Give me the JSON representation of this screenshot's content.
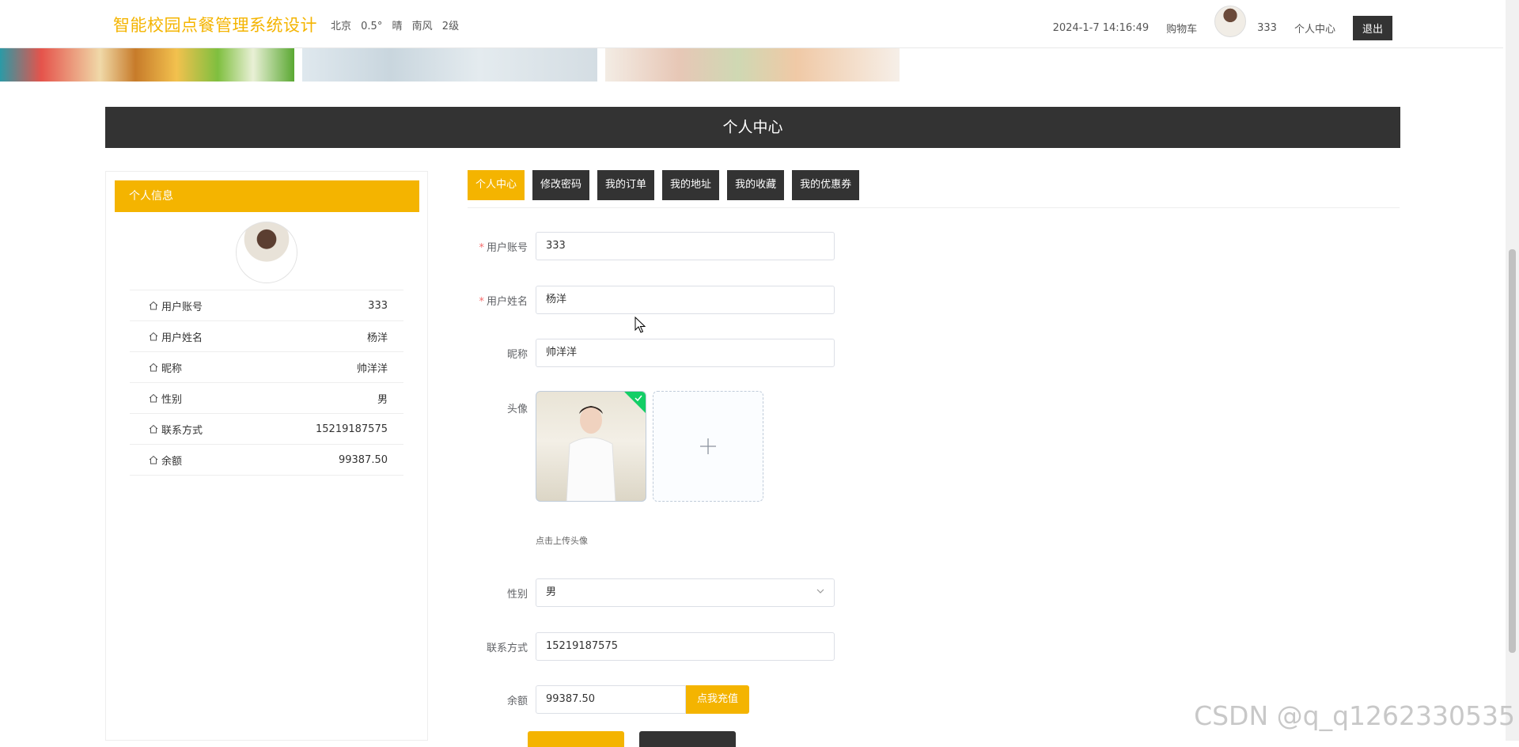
{
  "header": {
    "site_title": "智能校园点餐管理系统设计",
    "weather": {
      "city": "北京",
      "temp": "0.5°",
      "condition": "晴",
      "wind_dir": "南风",
      "wind_level": "2级"
    },
    "datetime": "2024-1-7 14:16:49",
    "cart_label": "购物车",
    "username": "333",
    "profile_label": "个人中心",
    "logout_label": "退出"
  },
  "page_title": "个人中心",
  "left_panel": {
    "heading": "个人信息",
    "rows": [
      {
        "label": "用户账号",
        "value": "333"
      },
      {
        "label": "用户姓名",
        "value": "杨洋"
      },
      {
        "label": "昵称",
        "value": "帅洋洋"
      },
      {
        "label": "性别",
        "value": "男"
      },
      {
        "label": "联系方式",
        "value": "15219187575"
      },
      {
        "label": "余额",
        "value": "99387.50"
      }
    ]
  },
  "tabs": [
    {
      "label": "个人中心",
      "active": true
    },
    {
      "label": "修改密码"
    },
    {
      "label": "我的订单"
    },
    {
      "label": "我的地址"
    },
    {
      "label": "我的收藏"
    },
    {
      "label": "我的优惠券"
    }
  ],
  "form": {
    "account": {
      "label": "用户账号",
      "value": "333"
    },
    "name": {
      "label": "用户姓名",
      "value": "杨洋"
    },
    "nickname": {
      "label": "昵称",
      "value": "帅洋洋"
    },
    "avatar": {
      "label": "头像",
      "tip": "点击上传头像"
    },
    "gender": {
      "label": "性别",
      "value": "男"
    },
    "phone": {
      "label": "联系方式",
      "value": "15219187575"
    },
    "balance": {
      "label": "余额",
      "value": "99387.50",
      "recharge_label": "点我充值"
    },
    "required_mark": "*"
  },
  "watermark": "CSDN @q_q1262330535",
  "colors": {
    "accent": "#f4b400",
    "dark": "#333333",
    "success": "#13ce66"
  }
}
